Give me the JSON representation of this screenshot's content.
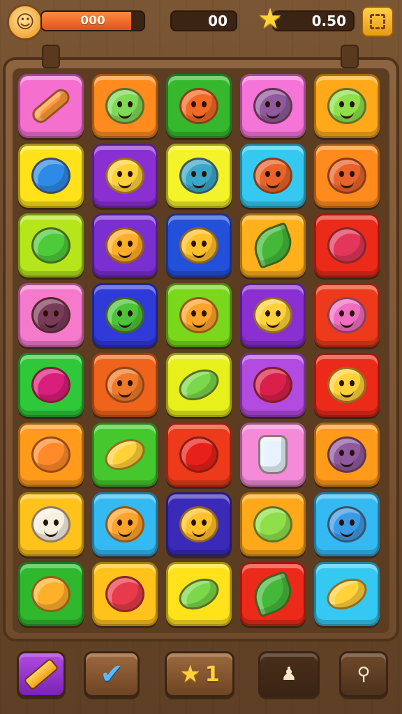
{
  "hud": {
    "energy_value": "000",
    "energy_fill_percent": 88,
    "score_value": "00",
    "stars_value": "0.50",
    "avatar_icon": "smiling-cat-face-icon",
    "star_icon": "star-icon",
    "menu_icon": "grid-menu-icon"
  },
  "board": {
    "rows": 8,
    "cols": 5,
    "tiles": [
      [
        {
          "bg": "#f56fcf",
          "item": "bar",
          "color": "#ff9a3a",
          "name": "candy-bar-icon"
        },
        {
          "bg": "#ff8a1e",
          "item": "face",
          "color": "#7ed957",
          "name": "green-blob-face-icon"
        },
        {
          "bg": "#35b82e",
          "item": "face",
          "color": "#f06a24",
          "name": "orange-face-icon"
        },
        {
          "bg": "#f574d8",
          "item": "face",
          "color": "#8f5a9e",
          "name": "purple-face-icon"
        },
        {
          "bg": "#ffa91a",
          "item": "face",
          "color": "#8fe04a",
          "name": "lime-face-icon"
        }
      ],
      [
        {
          "bg": "#ffe21a",
          "item": "round",
          "color": "#2d8ae6",
          "name": "blueberry-icon"
        },
        {
          "bg": "#8a2fd1",
          "item": "face",
          "color": "#ffd23a",
          "name": "yellow-face-icon"
        },
        {
          "bg": "#f4f228",
          "item": "face",
          "color": "#3aa7c8",
          "name": "teal-face-icon"
        },
        {
          "bg": "#35c9f2",
          "item": "face",
          "color": "#e8642a",
          "name": "orange-face-icon"
        },
        {
          "bg": "#ff8a1e",
          "item": "face",
          "color": "#e8642a",
          "name": "orange-face-icon"
        }
      ],
      [
        {
          "bg": "#b5e61c",
          "item": "round",
          "color": "#4ecb3a",
          "name": "green-apple-icon"
        },
        {
          "bg": "#7a2fd1",
          "item": "face",
          "color": "#ffae2a",
          "name": "orange-face-icon"
        },
        {
          "bg": "#2350d8",
          "item": "face",
          "color": "#ffc02a",
          "name": "yellow-face-icon"
        },
        {
          "bg": "#ffb01a",
          "item": "leaf",
          "color": "#45b83a",
          "name": "leaf-icon"
        },
        {
          "bg": "#ec2a1a",
          "item": "round",
          "color": "#e2365a",
          "name": "strawberry-icon"
        }
      ],
      [
        {
          "bg": "#f57acc",
          "item": "face",
          "color": "#7a3b5a",
          "name": "plum-face-icon"
        },
        {
          "bg": "#2f3ad8",
          "item": "face",
          "color": "#4cc43a",
          "name": "green-face-icon"
        },
        {
          "bg": "#7ad81c",
          "item": "face",
          "color": "#ffa42a",
          "name": "orange-face-icon"
        },
        {
          "bg": "#8a2fd1",
          "item": "face",
          "color": "#ffd23a",
          "name": "yellow-face-icon"
        },
        {
          "bg": "#ec3a1a",
          "item": "face",
          "color": "#f06ec0",
          "name": "pink-face-icon"
        }
      ],
      [
        {
          "bg": "#2fc83a",
          "item": "round",
          "color": "#d81e7a",
          "name": "berry-icon"
        },
        {
          "bg": "#f0631a",
          "item": "face",
          "color": "#f07a2a",
          "name": "orange-face-icon"
        },
        {
          "bg": "#e8f01c",
          "item": "oval",
          "color": "#7ad84a",
          "name": "green-bean-icon"
        },
        {
          "bg": "#b24be0",
          "item": "round",
          "color": "#d8204a",
          "name": "red-fruit-icon"
        },
        {
          "bg": "#ec2a1a",
          "item": "face",
          "color": "#ffd23a",
          "name": "yellow-face-icon"
        }
      ],
      [
        {
          "bg": "#ff9a1a",
          "item": "round",
          "color": "#ff8a2a",
          "name": "carrot-icon"
        },
        {
          "bg": "#45c82e",
          "item": "oval",
          "color": "#ffd23a",
          "name": "lemon-icon"
        },
        {
          "bg": "#ec3a1a",
          "item": "round",
          "color": "#e8201a",
          "name": "red-apple-icon"
        },
        {
          "bg": "#f58ad8",
          "item": "jug",
          "color": "#e6f2ff",
          "name": "milk-jug-icon"
        },
        {
          "bg": "#ff9a1a",
          "item": "face",
          "color": "#8f5a9e",
          "name": "purple-face-icon"
        }
      ],
      [
        {
          "bg": "#ffc21a",
          "item": "face",
          "color": "#f5f0e0",
          "name": "white-face-icon"
        },
        {
          "bg": "#35b9f2",
          "item": "face",
          "color": "#ffa42a",
          "name": "orange-face-icon"
        },
        {
          "bg": "#3a2ab8",
          "item": "face",
          "color": "#ffc02a",
          "name": "yellow-face-icon"
        },
        {
          "bg": "#ffa81a",
          "item": "round",
          "color": "#8ee04a",
          "name": "green-apple-icon"
        },
        {
          "bg": "#35b9f2",
          "item": "face",
          "color": "#3a9ae6",
          "name": "blue-face-icon"
        }
      ],
      [
        {
          "bg": "#2fb82e",
          "item": "round",
          "color": "#ffb02a",
          "name": "pineapple-icon"
        },
        {
          "bg": "#ffc21a",
          "item": "round",
          "color": "#e83a4a",
          "name": "raspberry-icon"
        },
        {
          "bg": "#ffe21a",
          "item": "oval",
          "color": "#7ad84a",
          "name": "green-bean-icon"
        },
        {
          "bg": "#ec2a1a",
          "item": "leaf",
          "color": "#45b83a",
          "name": "leaf-icon"
        },
        {
          "bg": "#35c9f2",
          "item": "oval",
          "color": "#ffd23a",
          "name": "lemon-icon"
        }
      ]
    ]
  },
  "toolbar": {
    "star_count": "1",
    "tools": [
      "pencil-booster-icon",
      "check-booster-icon",
      "star-booster-icon",
      "gloves-booster-icon",
      "bone-booster-icon"
    ]
  }
}
